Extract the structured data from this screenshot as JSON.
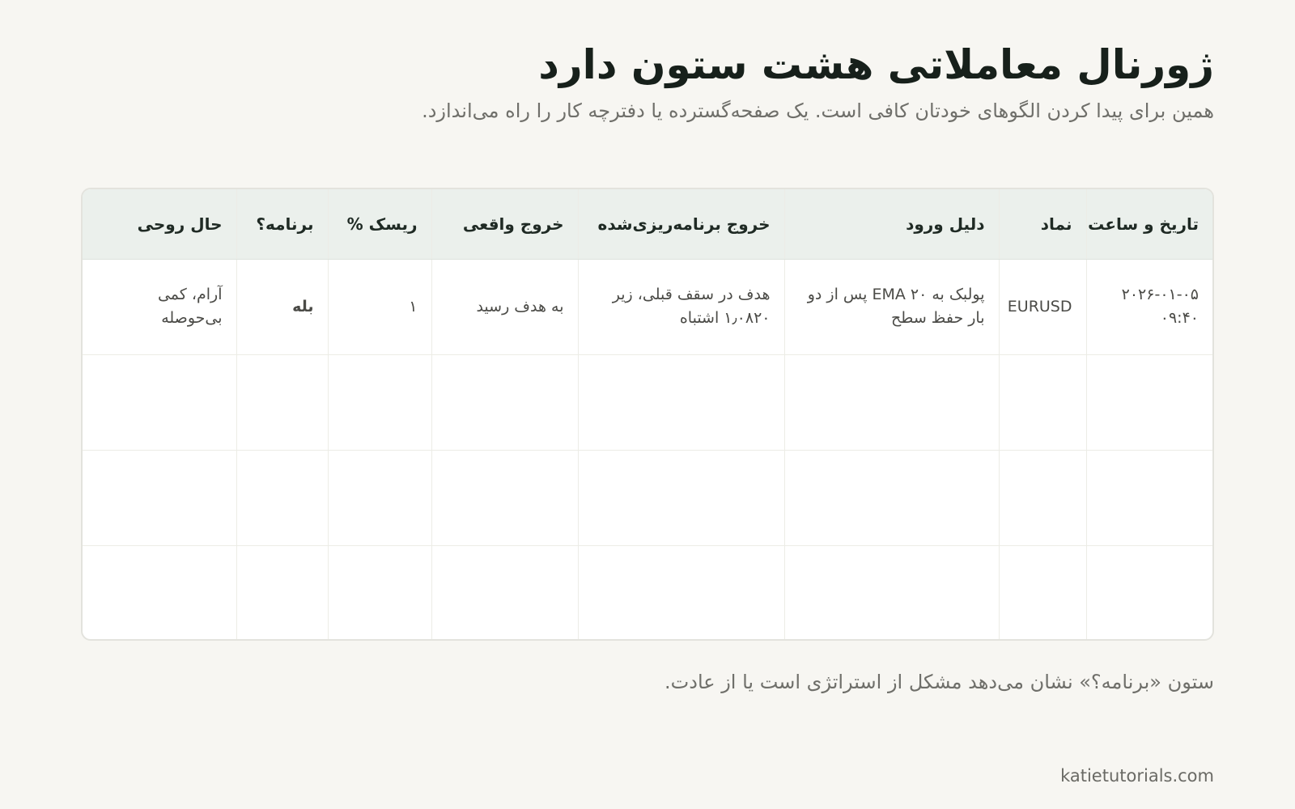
{
  "header": {
    "title": "ژورنال معاملاتی هشت ستون دارد",
    "subtitle": "همین برای پیدا کردن الگوهای خودتان کافی است. یک صفحه‌گسترده یا دفترچه کار را راه می‌اندازد."
  },
  "table": {
    "columns": [
      "تاریخ و ساعت",
      "نماد",
      "دلیل ورود",
      "خروج برنامه‌ریزی‌شده",
      "خروج واقعی",
      "ریسک %",
      "برنامه؟",
      "حال روحی"
    ],
    "rows": [
      [
        "۲۰۲۶-۰۱-۰۵ ۰۹:۴۰",
        "EURUSD",
        "پولبک به EMA ۲۰ پس از دو بار حفظ سطح",
        "هدف در سقف قبلی، زیر ۱٫۰۸۲۰ اشتباه",
        "به هدف رسید",
        "۱",
        "بله",
        "آرام، کمی بی‌حوصله"
      ],
      [
        "",
        "",
        "",
        "",
        "",
        "",
        "",
        ""
      ],
      [
        "",
        "",
        "",
        "",
        "",
        "",
        "",
        ""
      ],
      [
        "",
        "",
        "",
        "",
        "",
        "",
        "",
        ""
      ]
    ]
  },
  "footer": {
    "note": "ستون «برنامه؟» نشان می‌دهد مشکل از استراتژی است یا از عادت.",
    "credit": "katietutorials.com"
  },
  "colors": {
    "background": "#f7f6f2",
    "header_row": "#ebf0ec",
    "plan_yes": "#157a5b",
    "muted_text": "#6f6f6a"
  }
}
